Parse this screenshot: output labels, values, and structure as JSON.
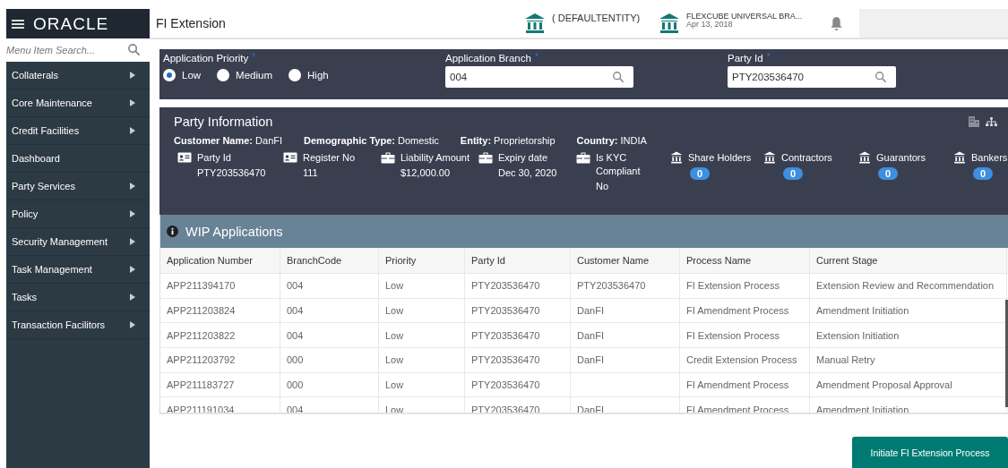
{
  "sidebar": {
    "logo": "ORACLE",
    "search": {
      "placeholder": "Menu Item Search..."
    },
    "items": [
      {
        "label": "Collaterals",
        "submenu": true
      },
      {
        "label": "Core Maintenance",
        "submenu": true
      },
      {
        "label": "Credit Facilities",
        "submenu": true
      },
      {
        "label": "Dashboard",
        "submenu": false
      },
      {
        "label": "Party Services",
        "submenu": true
      },
      {
        "label": "Policy",
        "submenu": true
      },
      {
        "label": "Security Management",
        "submenu": true
      },
      {
        "label": "Task Management",
        "submenu": true
      },
      {
        "label": "Tasks",
        "submenu": true
      },
      {
        "label": "Transaction Facilitors",
        "submenu": true
      }
    ]
  },
  "header": {
    "title": "FI Extension",
    "entity": "( DEFAULTENTITY)",
    "branch": "FLEXCUBE UNIVERSAL BRA...",
    "date": "Apr 13, 2018"
  },
  "form": {
    "priority": {
      "label": "Application Priority",
      "required_mark": "*",
      "options": [
        {
          "label": "Low",
          "selected": true
        },
        {
          "label": "Medium",
          "selected": false
        },
        {
          "label": "High",
          "selected": false
        }
      ]
    },
    "branch": {
      "label": "Application Branch",
      "required_mark": "*",
      "value": "004"
    },
    "party_id": {
      "label": "Party Id",
      "required_mark": "*",
      "value": "PTY203536470"
    }
  },
  "party_info": {
    "title": "Party Information",
    "facts": [
      {
        "label": "Customer Name:",
        "value": "DanFI"
      },
      {
        "label": "Demographic Type:",
        "value": "Domestic"
      },
      {
        "label": "Entity:",
        "value": "Proprietorship"
      },
      {
        "label": "Country:",
        "value": "INDIA"
      }
    ],
    "details": [
      {
        "kind": "card",
        "label": "Party Id",
        "value": "PTY203536470"
      },
      {
        "kind": "card",
        "label": "Register No",
        "value": "111"
      },
      {
        "kind": "briefcase",
        "label": "Liability Amount",
        "value": "$12,000.00"
      },
      {
        "kind": "briefcase",
        "label": "Expiry date",
        "value": "Dec 30, 2020"
      },
      {
        "kind": "briefcase",
        "label": "Is KYC Compliant",
        "value": "No"
      }
    ],
    "counts": [
      {
        "label": "Share Holders",
        "count": "0"
      },
      {
        "label": "Contractors",
        "count": "0"
      },
      {
        "label": "Guarantors",
        "count": "0"
      },
      {
        "label": "Bankers",
        "count": "0"
      }
    ]
  },
  "wip": {
    "title": "WIP Applications",
    "columns": [
      "Application Number",
      "BranchCode",
      "Priority",
      "Party Id",
      "Customer Name",
      "Process Name",
      "Current Stage"
    ],
    "rows": [
      [
        "APP211394170",
        "004",
        "Low",
        "PTY203536470",
        "PTY203536470",
        "FI Extension Process",
        "Extension Review and Recommendation"
      ],
      [
        "APP211203824",
        "004",
        "Low",
        "PTY203536470",
        "DanFI",
        "FI Amendment Process",
        "Amendment Initiation"
      ],
      [
        "APP211203822",
        "004",
        "Low",
        "PTY203536470",
        "DanFI",
        "FI Extension Process",
        "Extension Initiation"
      ],
      [
        "APP211203792",
        "000",
        "Low",
        "PTY203536470",
        "DanFI",
        "Credit Extension Process",
        "Manual Retry"
      ],
      [
        "APP211183727",
        "000",
        "Low",
        "PTY203536470",
        "",
        "FI Amendment Process",
        "Amendment Proposal Approval"
      ],
      [
        "APP211191034",
        "004",
        "Low",
        "PTY203536470",
        "DanFI",
        "FI Amendment Process",
        "Amendment Initiation"
      ]
    ]
  },
  "action": "Initiate FI Extension Process"
}
